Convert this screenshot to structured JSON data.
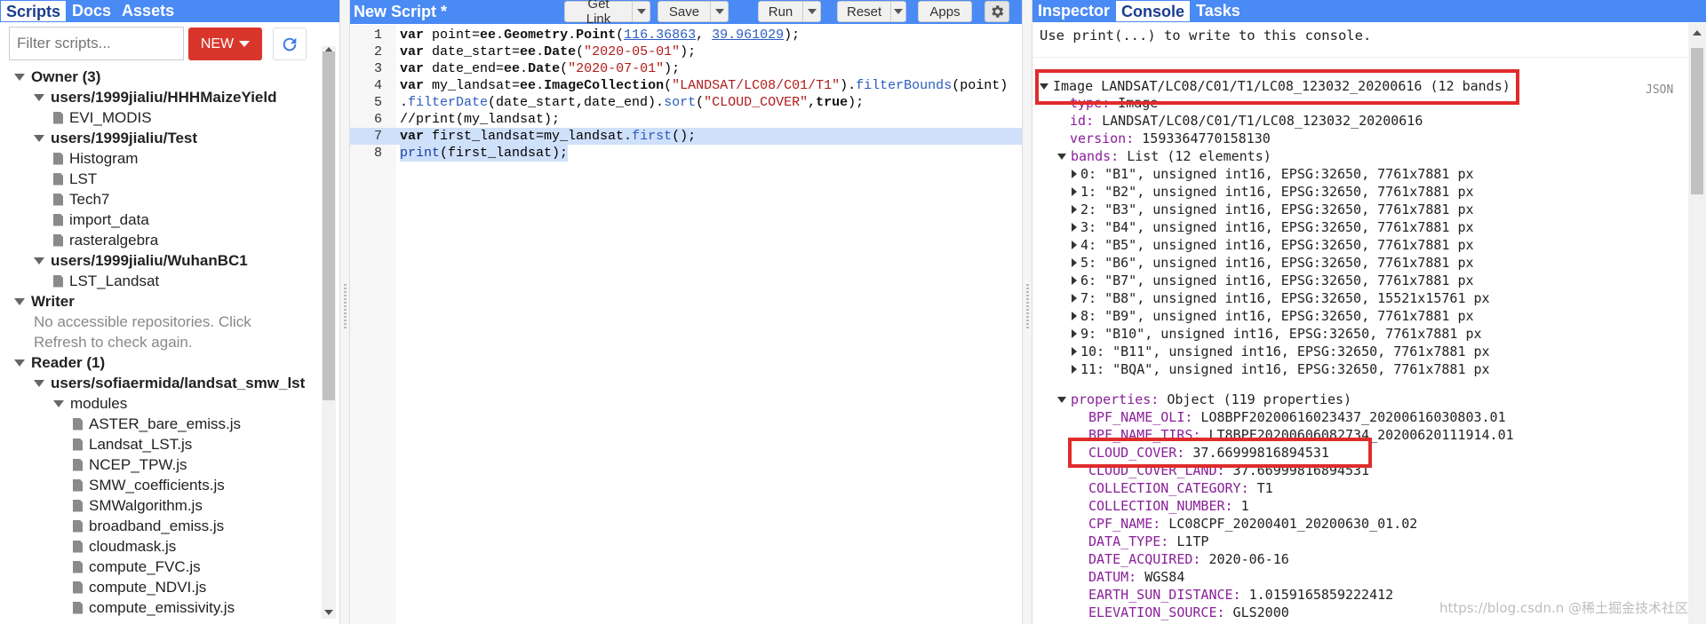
{
  "left": {
    "tabs": [
      "Scripts",
      "Docs",
      "Assets"
    ],
    "filter_placeholder": "Filter scripts...",
    "new_label": "NEW",
    "tree": [
      {
        "label": "Owner (3)",
        "type": "group",
        "indent": 0
      },
      {
        "label": "users/1999jialiu/HHHMaizeYield",
        "type": "repo",
        "indent": 1
      },
      {
        "label": "EVI_MODIS",
        "type": "file",
        "indent": 2
      },
      {
        "label": "users/1999jialiu/Test",
        "type": "repo",
        "indent": 1
      },
      {
        "label": "Histogram",
        "type": "file",
        "indent": 2
      },
      {
        "label": "LST",
        "type": "file",
        "indent": 2
      },
      {
        "label": "Tech7",
        "type": "file",
        "indent": 2
      },
      {
        "label": "import_data",
        "type": "file",
        "indent": 2
      },
      {
        "label": "rasteralgebra",
        "type": "file",
        "indent": 2
      },
      {
        "label": "users/1999jialiu/WuhanBC1",
        "type": "repo",
        "indent": 1
      },
      {
        "label": "LST_Landsat",
        "type": "file",
        "indent": 2
      },
      {
        "label": "Writer",
        "type": "group",
        "indent": 0
      },
      {
        "label": "No accessible repositories. Click",
        "type": "note",
        "indent": 1
      },
      {
        "label": "Refresh to check again.",
        "type": "note",
        "indent": 1
      },
      {
        "label": "Reader (1)",
        "type": "group",
        "indent": 0
      },
      {
        "label": "users/sofiaermida/landsat_smw_lst",
        "type": "repo",
        "indent": 1
      },
      {
        "label": "modules",
        "type": "folder",
        "indent": 2
      },
      {
        "label": "ASTER_bare_emiss.js",
        "type": "file",
        "indent": 3
      },
      {
        "label": "Landsat_LST.js",
        "type": "file",
        "indent": 3
      },
      {
        "label": "NCEP_TPW.js",
        "type": "file",
        "indent": 3
      },
      {
        "label": "SMW_coefficients.js",
        "type": "file",
        "indent": 3
      },
      {
        "label": "SMWalgorithm.js",
        "type": "file",
        "indent": 3
      },
      {
        "label": "broadband_emiss.js",
        "type": "file",
        "indent": 3
      },
      {
        "label": "cloudmask.js",
        "type": "file",
        "indent": 3
      },
      {
        "label": "compute_FVC.js",
        "type": "file",
        "indent": 3
      },
      {
        "label": "compute_NDVI.js",
        "type": "file",
        "indent": 3
      },
      {
        "label": "compute_emissivity.js",
        "type": "file",
        "indent": 3
      }
    ]
  },
  "center": {
    "title": "New Script *",
    "buttons": {
      "get_link": "Get Link",
      "save": "Save",
      "run": "Run",
      "reset": "Reset",
      "apps": "Apps"
    },
    "line_numbers": [
      "1",
      "2",
      "3",
      "4",
      "5",
      "6",
      "7",
      "8"
    ]
  },
  "right": {
    "tabs": [
      "Inspector",
      "Console",
      "Tasks"
    ],
    "hint": "Use print(...) to write to this console.",
    "json_label": "JSON",
    "image_header": "Image LANDSAT/LC08/C01/T1/LC08_123032_20200616 (12 bands)",
    "type_key": "type:",
    "type_val": " Image",
    "id_key": "id:",
    "id_val": " LANDSAT/LC08/C01/T1/LC08_123032_20200616",
    "version_key": "version:",
    "version_val": " 1593364770158130",
    "bands_key": "bands:",
    "bands_val": " List (12 elements)",
    "bands": [
      "0: \"B1\", unsigned int16, EPSG:32650, 7761x7881 px",
      "1: \"B2\", unsigned int16, EPSG:32650, 7761x7881 px",
      "2: \"B3\", unsigned int16, EPSG:32650, 7761x7881 px",
      "3: \"B4\", unsigned int16, EPSG:32650, 7761x7881 px",
      "4: \"B5\", unsigned int16, EPSG:32650, 7761x7881 px",
      "5: \"B6\", unsigned int16, EPSG:32650, 7761x7881 px",
      "6: \"B7\", unsigned int16, EPSG:32650, 7761x7881 px",
      "7: \"B8\", unsigned int16, EPSG:32650, 15521x15761 px",
      "8: \"B9\", unsigned int16, EPSG:32650, 7761x7881 px",
      "9: \"B10\", unsigned int16, EPSG:32650, 7761x7881 px",
      "10: \"B11\", unsigned int16, EPSG:32650, 7761x7881 px",
      "11: \"BQA\", unsigned int16, EPSG:32650, 7761x7881 px"
    ],
    "properties_key": "properties:",
    "properties_val": " Object (119 properties)",
    "properties": [
      {
        "k": "BPF_NAME_OLI:",
        "v": " LO8BPF20200616023437_20200616030803.01"
      },
      {
        "k": "BPF_NAME_TIRS:",
        "v": " LT8BPF20200606082734_20200620111914.01"
      },
      {
        "k": "CLOUD_COVER:",
        "v": " 37.66999816894531"
      },
      {
        "k": "CLOUD_COVER_LAND:",
        "v": " 37.66999816894531"
      },
      {
        "k": "COLLECTION_CATEGORY:",
        "v": " T1"
      },
      {
        "k": "COLLECTION_NUMBER:",
        "v": " 1"
      },
      {
        "k": "CPF_NAME:",
        "v": " LC08CPF_20200401_20200630_01.02"
      },
      {
        "k": "DATA_TYPE:",
        "v": " L1TP"
      },
      {
        "k": "DATE_ACQUIRED:",
        "v": " 2020-06-16"
      },
      {
        "k": "DATUM:",
        "v": " WGS84"
      },
      {
        "k": "EARTH_SUN_DISTANCE:",
        "v": " 1.0159165859222412"
      },
      {
        "k": "ELEVATION_SOURCE:",
        "v": " GLS2000"
      }
    ],
    "watermark": "https://blog.csdn.n @稀土掘金技术社区"
  },
  "colors": {
    "header_blue": "#4a8af4",
    "highlight": "#e02b2b",
    "new_button": "#d9362b"
  }
}
